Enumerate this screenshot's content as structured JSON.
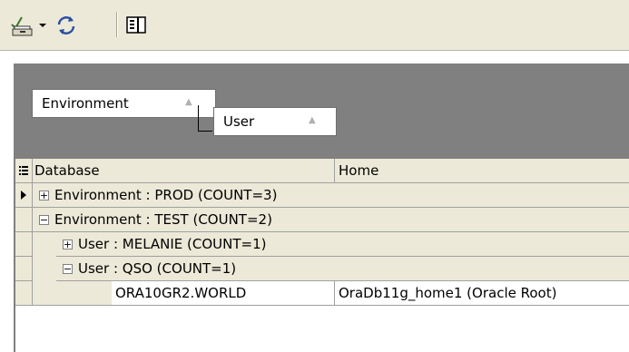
{
  "toolbar": {
    "buttons": [
      {
        "name": "edit-list-icon",
        "has_dropdown": true
      },
      {
        "name": "refresh-icon"
      },
      {
        "name": "columns-icon"
      }
    ]
  },
  "grid": {
    "group_by": [
      {
        "label": "Environment",
        "sort": "ascending"
      },
      {
        "label": "User",
        "sort": "ascending"
      }
    ],
    "columns": [
      "Database",
      "Home"
    ],
    "rows": [
      {
        "type": "group",
        "level": 0,
        "expanded": false,
        "selected": true,
        "label": "Environment : PROD (COUNT=3)"
      },
      {
        "type": "group",
        "level": 0,
        "expanded": true,
        "selected": false,
        "label": "Environment : TEST (COUNT=2)"
      },
      {
        "type": "group",
        "level": 1,
        "expanded": false,
        "selected": false,
        "label": "User : MELANIE (COUNT=1)"
      },
      {
        "type": "group",
        "level": 1,
        "expanded": true,
        "selected": false,
        "label": "User : QSO (COUNT=1)"
      },
      {
        "type": "data",
        "database": "ORA10GR2.WORLD",
        "home": "OraDb11g_home1 (Oracle Root)"
      }
    ]
  },
  "colors": {
    "toolbar_bg": "#ece9d8",
    "group_area_bg": "#808080",
    "grid_line": "#a0a0a0"
  }
}
